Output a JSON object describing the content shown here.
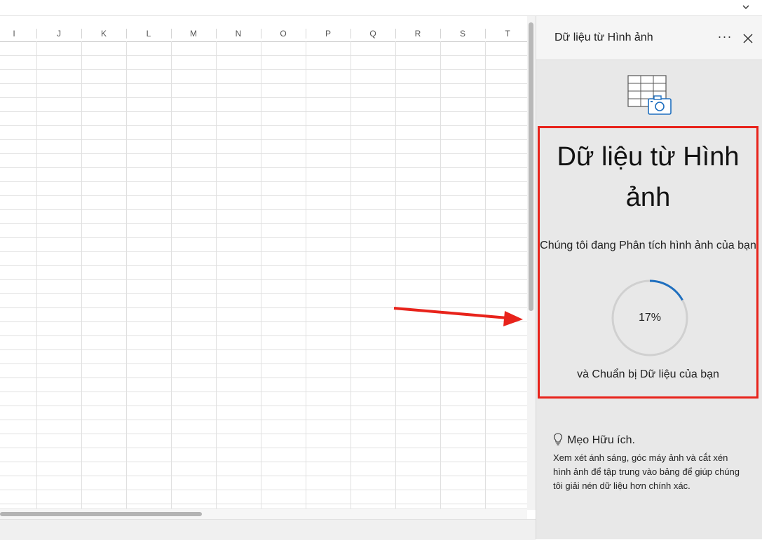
{
  "sheet": {
    "columns": [
      "I",
      "J",
      "K",
      "L",
      "M",
      "N",
      "O",
      "P",
      "Q",
      "R",
      "S",
      "T"
    ]
  },
  "pane": {
    "title": "Dữ liệu từ Hình ảnh",
    "more_label": "···",
    "heading": "Dữ liệu từ Hình ảnh",
    "analyzing_text": "Chúng tôi đang Phân tích hình ảnh của bạn",
    "progress_label": "17%",
    "progress_value": 17,
    "preparing_text": "và Chuẩn bị Dữ liệu của bạn",
    "tip_title": "Mẹo Hữu ích.",
    "tip_body": "Xem xét ánh sáng, góc máy ảnh và cắt xén hình ảnh để tập trung vào bảng để giúp chúng tôi giải nén dữ liệu hơn chính xác."
  },
  "colors": {
    "highlight": "#e8231b",
    "arrow": "#e8231b",
    "progress": "#1f6fbf",
    "progress_track": "#d0d0d0",
    "icon_blue": "#1f6fbf"
  }
}
